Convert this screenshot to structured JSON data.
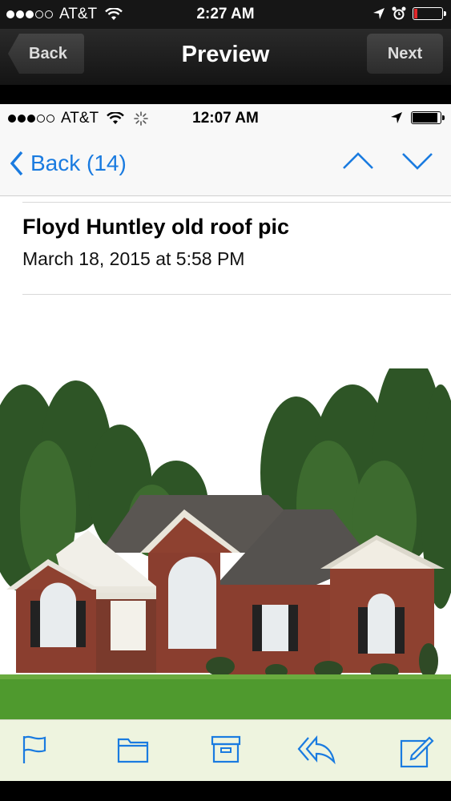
{
  "outer_status": {
    "carrier": "AT&T",
    "time": "2:27 AM"
  },
  "outer_nav": {
    "back_label": "Back",
    "title": "Preview",
    "next_label": "Next"
  },
  "inner_status": {
    "carrier": "AT&T",
    "time": "12:07 AM"
  },
  "mail_nav": {
    "back_label": "Back (14)"
  },
  "message": {
    "subject": "Floyd Huntley old roof pic",
    "date": "March 18, 2015 at 5:58 PM"
  },
  "attachment": {
    "icon": "house-photo"
  },
  "toolbar": {
    "icons": [
      "flag-icon",
      "folder-icon",
      "archive-icon",
      "reply-icon",
      "compose-icon"
    ]
  },
  "colors": {
    "ios_blue": "#1a7be0",
    "battery_low": "#e0282b"
  }
}
